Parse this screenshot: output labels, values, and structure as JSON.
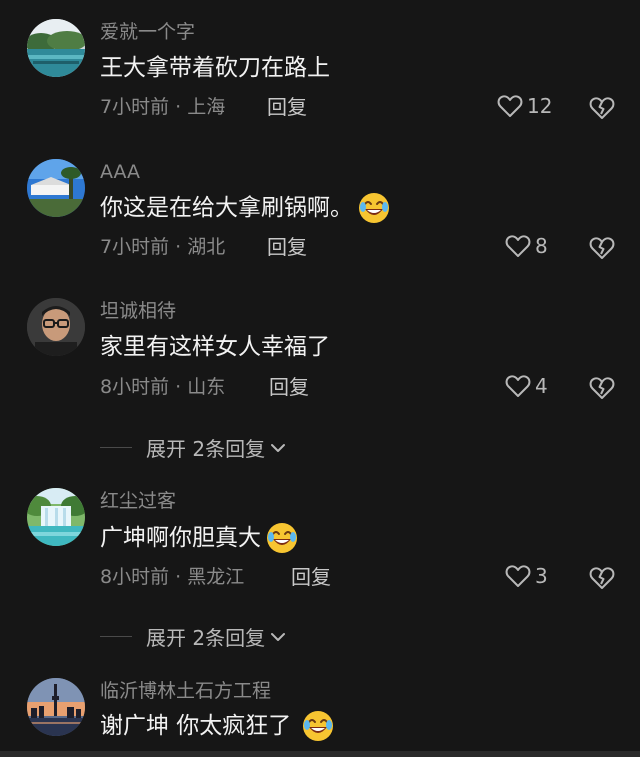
{
  "comments": [
    {
      "name": "爱就一个字",
      "text": "王大拿带着砍刀在路上",
      "has_emoji": false,
      "time": "7小时前 · 上海",
      "reply": "回复",
      "likes": "12",
      "avatar_icon": "landscape-river-avatar"
    },
    {
      "name": "AAA",
      "text": "你这是在给大拿刷锅啊。",
      "has_emoji": true,
      "time": "7小时前 · 湖北",
      "reply": "回复",
      "likes": "8",
      "avatar_icon": "sky-building-avatar"
    },
    {
      "name": "坦诚相待",
      "text": "家里有这样女人幸福了",
      "has_emoji": false,
      "time": "8小时前 · 山东",
      "reply": "回复",
      "likes": "4",
      "avatar_icon": "man-glasses-avatar"
    },
    {
      "name": "红尘过客",
      "text": "广坤啊你胆真大",
      "has_emoji": true,
      "time": "8小时前 · 黑龙江",
      "reply": "回复",
      "likes": "3",
      "avatar_icon": "waterfall-avatar"
    },
    {
      "name": "临沂博林土石方工程",
      "text": "谢广坤 你太疯狂了",
      "has_emoji": true,
      "avatar_icon": "city-tower-avatar"
    }
  ],
  "expand_replies": [
    {
      "label": "展开 2条回复"
    },
    {
      "label": "展开 2条回复"
    }
  ],
  "colors": {
    "background": "#161616",
    "name": "#8a8a8a",
    "text": "#f2f2f2",
    "meta": "#8a8a8a"
  },
  "icons": {
    "like": "heart-outline-icon",
    "dislike": "broken-heart-icon",
    "expand": "chevron-down-icon",
    "emoji": "laughing-crying-emoji"
  }
}
